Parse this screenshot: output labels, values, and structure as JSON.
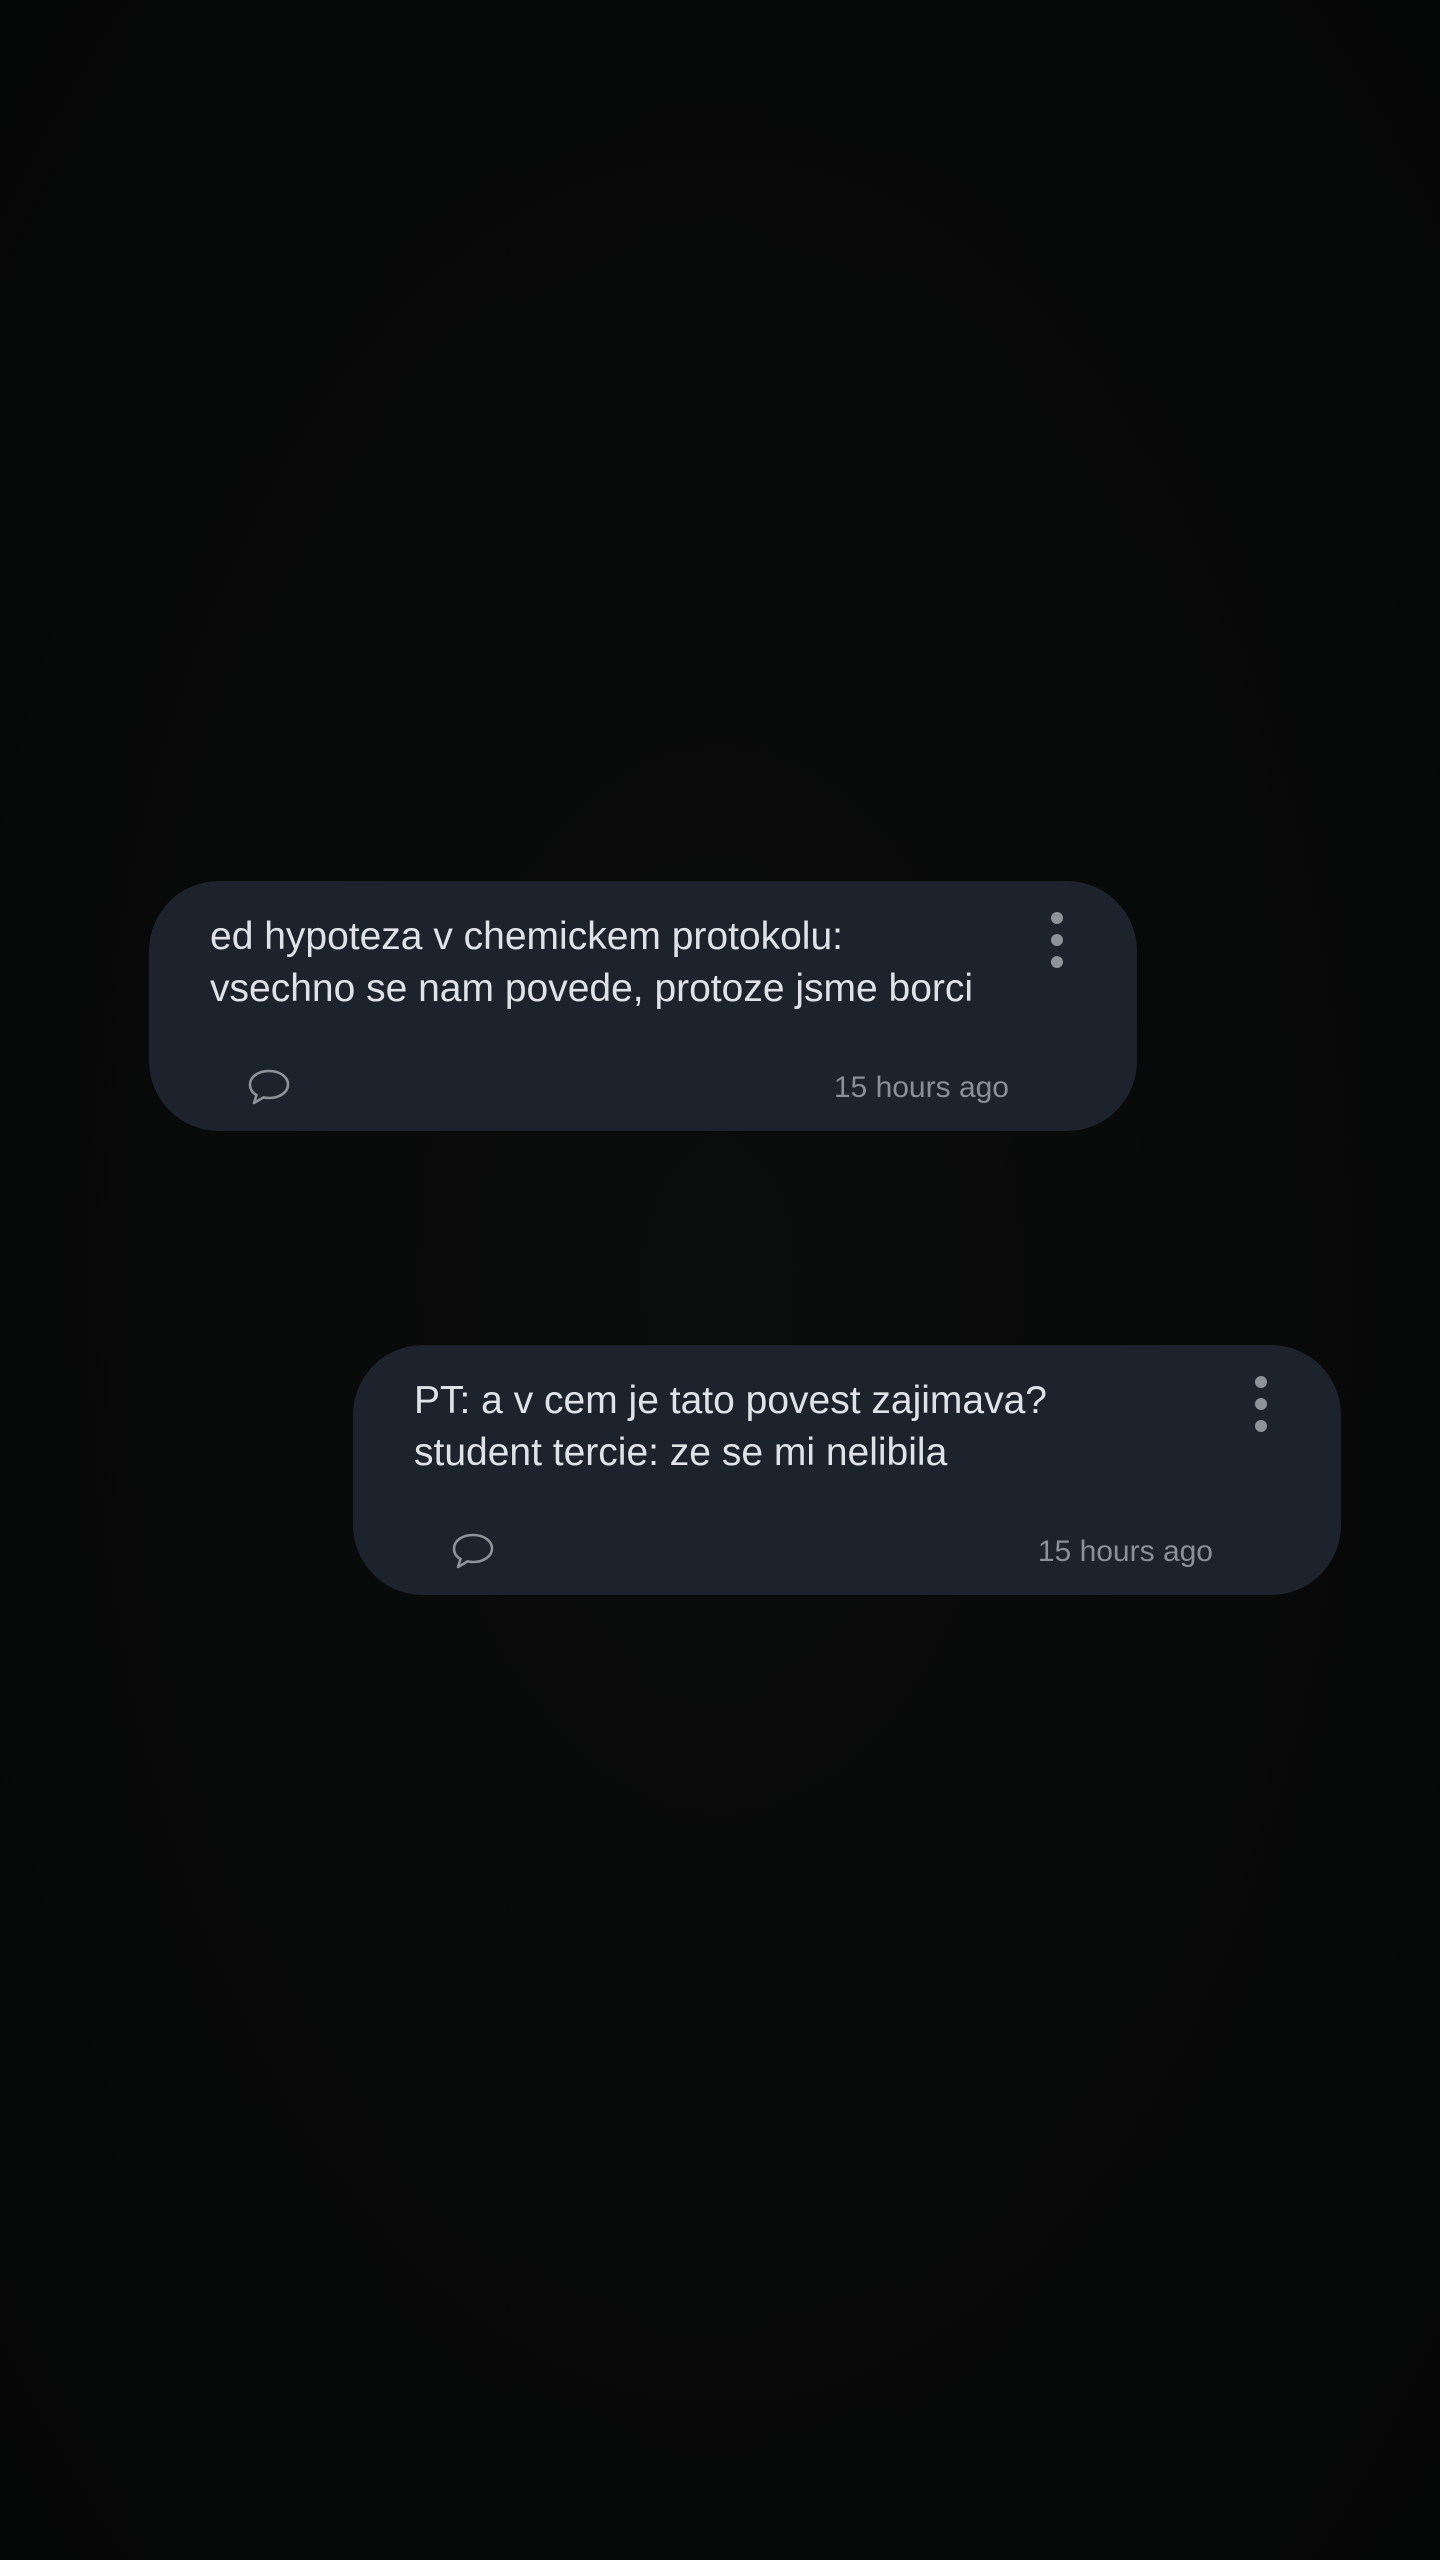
{
  "notes": [
    {
      "text": "ed hypoteza v chemickem protokolu:\nvsechno se nam povede, protoze jsme borci",
      "timestamp": "15 hours ago",
      "menu_icon": "more-vertical-icon",
      "comment_icon": "speech-bubble-icon"
    },
    {
      "text": "PT: a v cem je tato povest zajimava?\nstudent tercie: ze se mi nelibila",
      "timestamp": "15 hours ago",
      "menu_icon": "more-vertical-icon",
      "comment_icon": "speech-bubble-icon"
    }
  ],
  "colors": {
    "background": "#070808",
    "card": "#1d232d",
    "text": "#dfe3e8",
    "muted": "#8a9099"
  }
}
